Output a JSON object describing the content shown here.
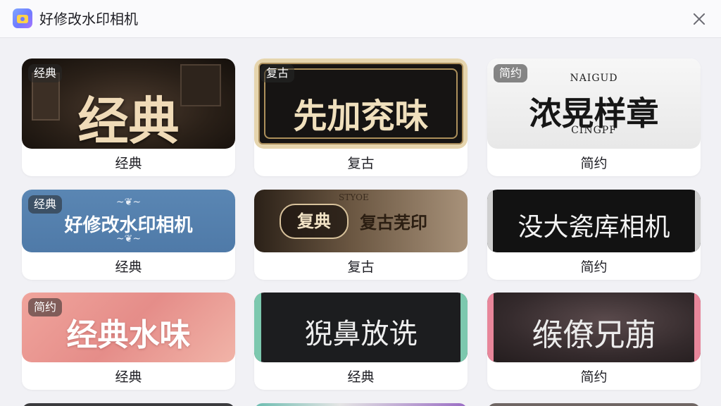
{
  "app": {
    "title": "好修改水印相机"
  },
  "icons": {
    "app": "app-camera-icon",
    "close": "close-icon"
  },
  "templates": [
    {
      "badge": "经典",
      "preview_text": "经典",
      "caption": "经典"
    },
    {
      "badge": "复古",
      "preview_text": "先加兖味",
      "caption": "复古"
    },
    {
      "badge": "简约",
      "preview_text": "浓晃样章",
      "caption": "简约",
      "ornament_top": "NAIGUD",
      "ornament_bottom": "CINGPF"
    },
    {
      "badge": "经典",
      "preview_text": "好修改水印相机",
      "caption": "经典"
    },
    {
      "badge": "",
      "preview_text": "复典",
      "preview_subtext": "复古芜印",
      "caption": "复古",
      "ornament_top": "STYOE"
    },
    {
      "badge": "",
      "preview_text": "没大瓷库相机",
      "caption": "简约"
    },
    {
      "badge": "简约",
      "preview_text": "经典水味",
      "caption": "经典"
    },
    {
      "badge": "",
      "preview_text": "猊鼻放诜",
      "caption": "经典"
    },
    {
      "badge": "",
      "preview_text": "缑僚兄萠",
      "caption": "简约"
    }
  ]
}
